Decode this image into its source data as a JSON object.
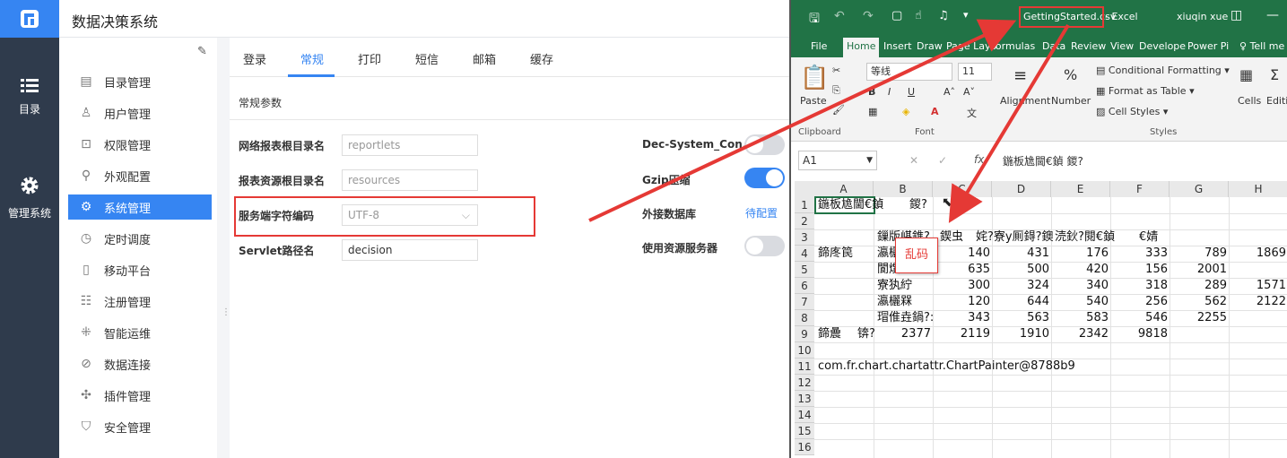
{
  "app": {
    "title": "数据决策系统",
    "rail": [
      {
        "label": "目录",
        "icon": "list-icon"
      },
      {
        "label": "管理系统",
        "icon": "gear-icon"
      }
    ],
    "sidebar_items": [
      {
        "label": "目录管理",
        "icon": "catalog-icon"
      },
      {
        "label": "用户管理",
        "icon": "user-icon"
      },
      {
        "label": "权限管理",
        "icon": "lock-icon"
      },
      {
        "label": "外观配置",
        "icon": "brush-icon"
      },
      {
        "label": "系统管理",
        "icon": "gear-icon",
        "active": true
      },
      {
        "label": "定时调度",
        "icon": "timer-icon"
      },
      {
        "label": "移动平台",
        "icon": "mobile-icon"
      },
      {
        "label": "注册管理",
        "icon": "register-icon"
      },
      {
        "label": "智能运维",
        "icon": "ops-icon"
      },
      {
        "label": "数据连接",
        "icon": "link-icon"
      },
      {
        "label": "插件管理",
        "icon": "plugin-icon"
      },
      {
        "label": "安全管理",
        "icon": "shield-icon"
      }
    ],
    "tabs": [
      "登录",
      "常规",
      "打印",
      "短信",
      "邮箱",
      "缓存"
    ],
    "active_tab": "常规",
    "section_title": "常规参数",
    "fields": [
      {
        "label": "网络报表根目录名",
        "value": "reportlets"
      },
      {
        "label": "报表资源根目录名",
        "value": "resources"
      },
      {
        "label": "服务端字符编码",
        "value": "UTF-8"
      },
      {
        "label": "Servlet路径名",
        "value": "decision"
      }
    ],
    "right_settings": [
      {
        "label": "Dec-System_Con...",
        "type": "toggle",
        "on": false
      },
      {
        "label": "Gzip压缩",
        "type": "toggle",
        "on": true
      },
      {
        "label": "外接数据库",
        "type": "link",
        "link_text": "待配置"
      },
      {
        "label": "使用资源服务器",
        "type": "toggle",
        "on": false
      }
    ],
    "accent_color": "#3685f2",
    "rail_color": "#2f3b4c"
  },
  "excel": {
    "filename": "GettingStarted.csv",
    "app_name": " - Excel",
    "user": "xiuqin xue",
    "ribbon_tabs": [
      "File",
      "Home",
      "Insert",
      "Draw",
      "Page Layo",
      "Formulas",
      "Data",
      "Review",
      "View",
      "Develope",
      "Power Pi",
      "Tell me"
    ],
    "active_ribbon_tab": "Home",
    "ribbon": {
      "paste": "Paste",
      "clipboard": "Clipboard",
      "font_name": "等线",
      "font_size": "11",
      "font_group": "Font",
      "alignment": "Alignment",
      "number": "Number",
      "conditional_formatting": "Conditional Formatting",
      "format_as_table": "Format as Table",
      "cell_styles": "Cell Styles",
      "styles_group": "Styles",
      "cells": "Cells",
      "editing": "Editi"
    },
    "name_box": "A1",
    "fx": "fx",
    "formula": "鍦板尯閫€鍞     鍐?",
    "columns": [
      "A",
      "B",
      "C",
      "D",
      "E",
      "F",
      "G",
      "H"
    ],
    "rows": [
      "1",
      "2",
      "3",
      "4",
      "5",
      "6",
      "7",
      "8",
      "9",
      "10",
      "11",
      "12",
      "13",
      "14",
      "15",
      "16"
    ],
    "cells": {
      "A1": "鍦板尯閫€鍞",
      "B1": "鍐?",
      "B3": "鏁版嵁鐎?",
      "C3": "鍥虫",
      "D3": "姹?寮y厠鍀?鐭",
      "E3": "涜鈥?閱€鍞",
      "F3": "€婧",
      "A4": "鍗庝笢",
      "B4": "瀛欐",
      "C4": "140",
      "D4": "431",
      "E4": "176",
      "F4": "333",
      "G4": "789",
      "H4": "1869",
      "B5": "閬熼",
      "C5": "635",
      "D5": "500",
      "E5": "420",
      "F5": "156",
      "G5": "2001",
      "B6": "寮犱紵",
      "C6": "300",
      "D6": "324",
      "E6": "340",
      "F6": "318",
      "G6": "289",
      "H6": "1571",
      "B7": "瀛欐槑",
      "C7": "120",
      "D7": "644",
      "E7": "540",
      "F7": "256",
      "G7": "562",
      "H7": "2122",
      "B8": "瑁倠垚鍋?:",
      "C8": "343",
      "D8": "563",
      "E8": "583",
      "F8": "546",
      "G8": "2255",
      "A9": "鍗曟",
      "A9b": "锛?",
      "B9": "2377",
      "C9": "2119",
      "D9": "1910",
      "E9": "2342",
      "F9": "9818",
      "A11": "com.fr.chart.chartattr.ChartPainter@8788b9"
    },
    "ribbon_color": "#217346"
  },
  "annotation": {
    "garbled_label": "乱码",
    "color": "#e53935"
  }
}
